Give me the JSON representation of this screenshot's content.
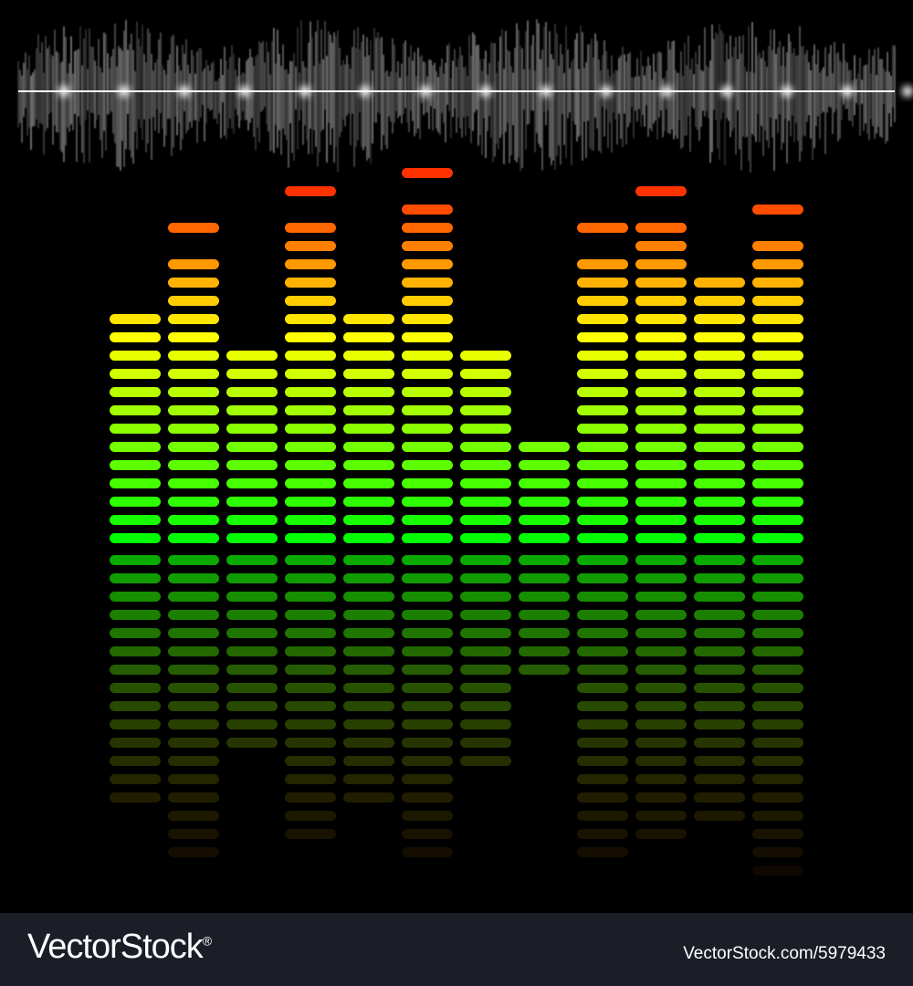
{
  "equalizer": {
    "levels_above_midline": [
      13,
      16,
      11,
      18,
      13,
      19,
      11,
      6,
      16,
      18,
      15,
      17
    ],
    "levels_below_midline": [
      14,
      17,
      11,
      16,
      14,
      17,
      12,
      7,
      17,
      16,
      15,
      18
    ],
    "peak_markers": [
      null,
      17,
      null,
      19,
      null,
      20,
      null,
      null,
      17,
      19,
      null,
      18
    ],
    "colors": {
      "low": "#00ff00",
      "mid": "#ffff00",
      "high": "#ff3300",
      "background": "#000000"
    }
  },
  "waveform": {
    "color": "#ffffff"
  },
  "footer": {
    "brand": "VectorStock",
    "brand_mark": "®",
    "image_id": "VectorStock.com/5979433",
    "background": "#1b1e27"
  }
}
